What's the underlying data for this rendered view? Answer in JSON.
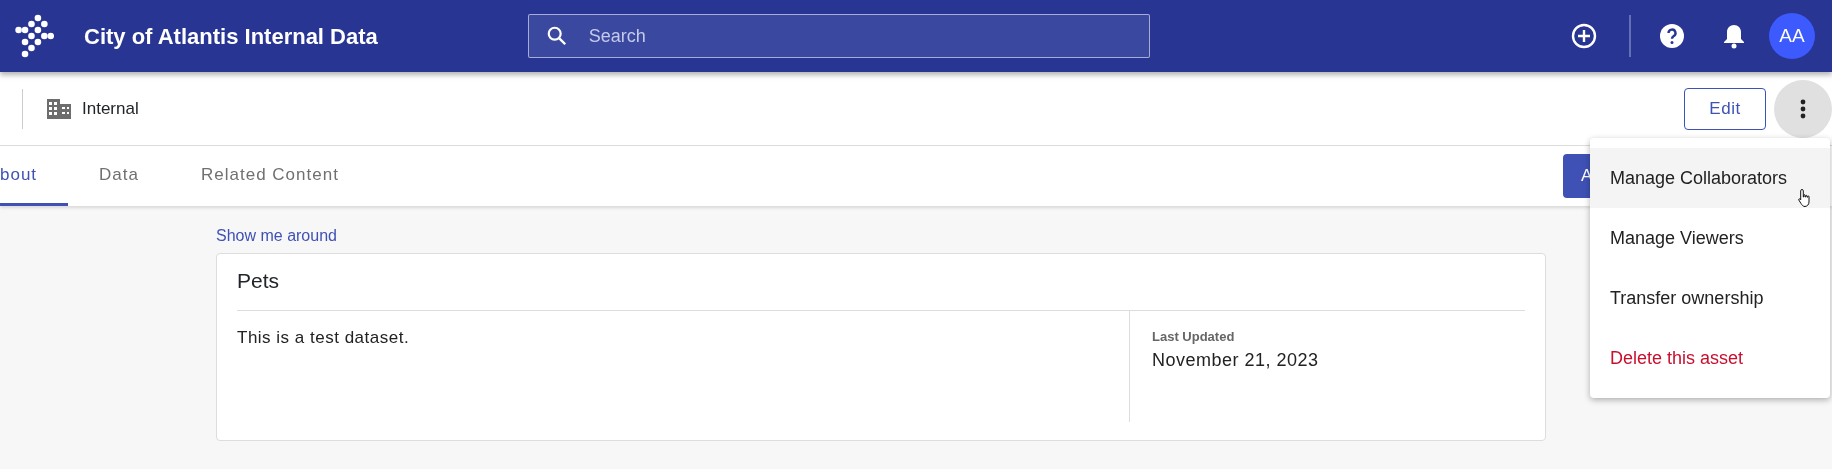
{
  "header": {
    "title": "City of Atlantis Internal Data",
    "search": {
      "placeholder": "Search"
    },
    "avatar": "AA"
  },
  "toolbar": {
    "location": "Internal",
    "edit_button": "Edit",
    "more_menu_open": true
  },
  "tabs": [
    {
      "label": "bout",
      "selected": true
    },
    {
      "label": "Data",
      "selected": false
    },
    {
      "label": "Related Content",
      "selected": false
    }
  ],
  "tabs_action_button": "A",
  "more_menu": [
    {
      "label": "Manage Collaborators",
      "kind": "normal",
      "hovered": true
    },
    {
      "label": "Manage Viewers",
      "kind": "normal",
      "hovered": false
    },
    {
      "label": "Transfer ownership",
      "kind": "normal",
      "hovered": false
    },
    {
      "label": "Delete this asset",
      "kind": "danger",
      "hovered": false
    }
  ],
  "tour_link": "Show me around",
  "card": {
    "title": "Pets",
    "description": "This is a test dataset.",
    "meta_label": "Last Updated",
    "meta_value": "November 21, 2023"
  }
}
